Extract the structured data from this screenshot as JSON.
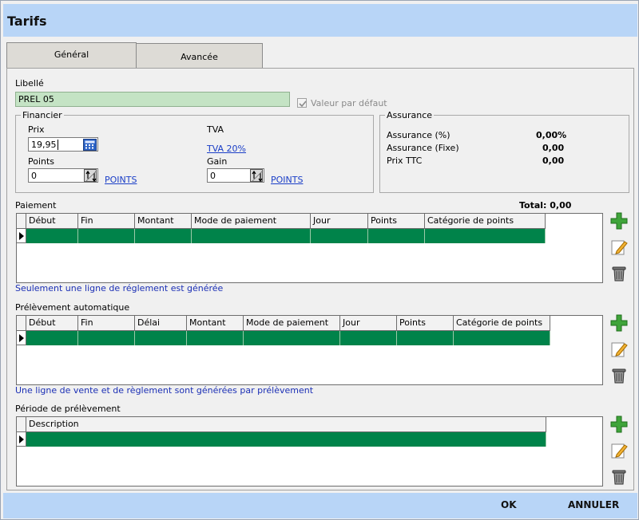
{
  "window": {
    "title": "Tarifs"
  },
  "tabs": [
    {
      "label": "Général",
      "active": true
    },
    {
      "label": "Avancée",
      "active": false
    }
  ],
  "libelle": {
    "label": "Libellé",
    "value": "PREL 05",
    "default_checkbox_label": "Valeur par défaut",
    "default_checked": true
  },
  "financier": {
    "title": "Financier",
    "prix_label": "Prix",
    "prix_value": "19,95",
    "tva_label": "TVA",
    "tva_link": "TVA 20%",
    "points_label": "Points",
    "points_value": "0",
    "points_link": "POINTS",
    "gain_label": "Gain",
    "gain_value": "0",
    "gain_link": "POINTS"
  },
  "assurance": {
    "title": "Assurance",
    "rows": [
      {
        "label": "Assurance (%)",
        "value": "0,00%"
      },
      {
        "label": "Assurance (Fixe)",
        "value": "0,00"
      },
      {
        "label": "Prix TTC",
        "value": "0,00"
      }
    ]
  },
  "paiement": {
    "title": "Paiement",
    "total": "Total: 0,00",
    "columns": [
      "Début",
      "Fin",
      "Montant",
      "Mode de paiement",
      "Jour",
      "Points",
      "Catégorie de points"
    ],
    "note": "Seulement une ligne de réglement est générée"
  },
  "prelevement": {
    "title": "Prélèvement automatique",
    "columns": [
      "Début",
      "Fin",
      "Délai",
      "Montant",
      "Mode de paiement",
      "Jour",
      "Points",
      "Catégorie de points"
    ],
    "note": "Une ligne de vente et de règlement sont générées par prélèvement"
  },
  "periode": {
    "title": "Période de prélèvement",
    "columns": [
      "Description"
    ]
  },
  "icons": {
    "add": "plus-icon",
    "edit": "pencil-icon",
    "delete": "trash-icon"
  },
  "colors": {
    "titlebar": "#b8d5f7",
    "selected_row": "#00834a",
    "libelle_bg": "#c4e3c4",
    "note_text": "#1b2fb5"
  },
  "footer": {
    "ok_label": "OK",
    "cancel_label": "ANNULER"
  }
}
